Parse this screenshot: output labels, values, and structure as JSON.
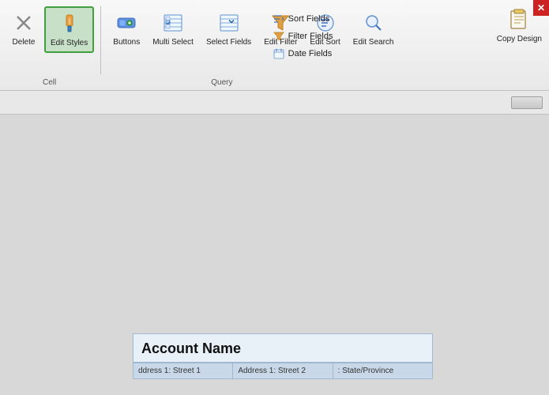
{
  "toolbar": {
    "cell_section_label": "Cell",
    "query_section_label": "Query",
    "items": [
      {
        "id": "delete",
        "label": "Delete",
        "icon": "delete-icon",
        "active": false
      },
      {
        "id": "edit-styles",
        "label": "Edit\nStyles",
        "icon": "edit-styles-icon",
        "active": true
      },
      {
        "id": "buttons",
        "label": "Buttons",
        "icon": "buttons-icon",
        "active": false
      },
      {
        "id": "multi-select",
        "label": "Multi\nSelect",
        "icon": "multi-select-icon",
        "active": false
      },
      {
        "id": "select-fields",
        "label": "Select\nFields",
        "icon": "select-fields-icon",
        "active": false
      },
      {
        "id": "edit-filter",
        "label": "Edit\nFilter",
        "icon": "edit-filter-icon",
        "active": false
      },
      {
        "id": "edit-sort",
        "label": "Edit\nSort",
        "icon": "edit-sort-icon",
        "active": false
      },
      {
        "id": "edit-search",
        "label": "Edit\nSearch",
        "icon": "edit-search-icon",
        "active": false
      }
    ],
    "small_items": [
      {
        "id": "sort-fields",
        "label": "Sort Fields",
        "icon": "sort-icon"
      },
      {
        "id": "filter-fields",
        "label": "Filter Fields",
        "icon": "filter-icon"
      },
      {
        "id": "date-fields",
        "label": "Date Fields",
        "icon": "date-icon"
      }
    ],
    "copy_design": {
      "label": "Copy\nDesign",
      "icon": "copy-design-icon"
    }
  },
  "form": {
    "title": "Account Name",
    "fields": [
      {
        "id": "street1",
        "label": "ddress 1: Street 1"
      },
      {
        "id": "street2",
        "label": "Address 1: Street 2"
      },
      {
        "id": "state",
        "label": ": State/Province"
      }
    ]
  },
  "close_label": "✕"
}
